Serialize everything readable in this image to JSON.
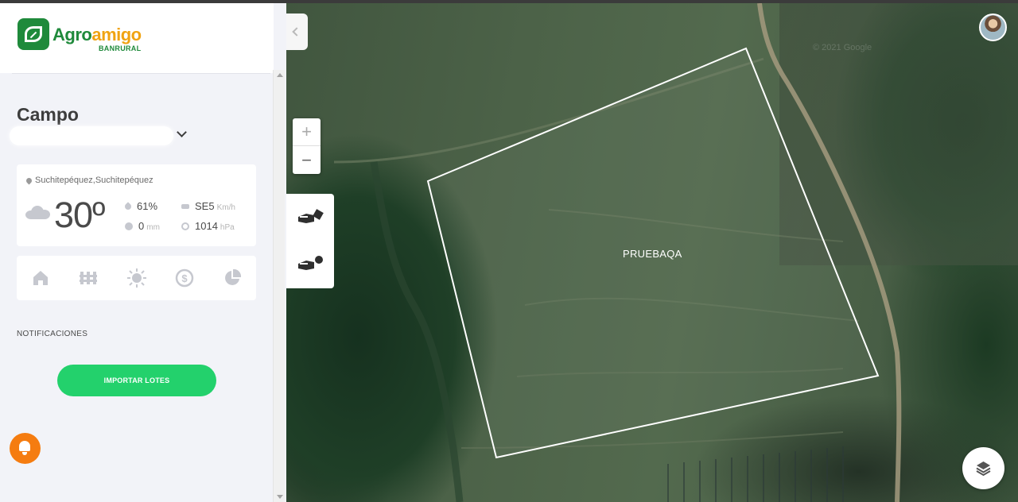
{
  "brand": {
    "name_part1": "Agro",
    "name_part2": "amigo",
    "subtitle": "BANRURAL",
    "primary_color": "#1f8a3b",
    "accent_color": "#f0a312"
  },
  "sidebar": {
    "title": "Campo",
    "farm_selector": {
      "value": "",
      "icon": "chevron-down-icon"
    },
    "weather": {
      "location": "Suchitepéquez,Suchitepéquez",
      "condition_icon": "cloud-icon",
      "temperature": "30º",
      "humidity": "61%",
      "rain_value": "0",
      "rain_unit": "mm",
      "wind_value": "SE5",
      "wind_unit": "Km/h",
      "pressure_value": "1014",
      "pressure_unit": "hPa"
    },
    "nav_icons": [
      "home-icon",
      "fence-icon",
      "sun-icon",
      "dollar-icon",
      "pie-chart-icon"
    ],
    "notifications_label": "NOTIFICACIONES",
    "import_button": "IMPORTAR LOTES",
    "import_button_color": "#23d16c",
    "bell_color": "#f57c10"
  },
  "map": {
    "lot_name": "PRUEBAQA",
    "watermark": "© 2021 Google",
    "zoom_in": "+",
    "zoom_out": "−",
    "tools": [
      "draw-polygon-icon",
      "draw-point-icon"
    ],
    "layers_icon": "layers-icon"
  }
}
